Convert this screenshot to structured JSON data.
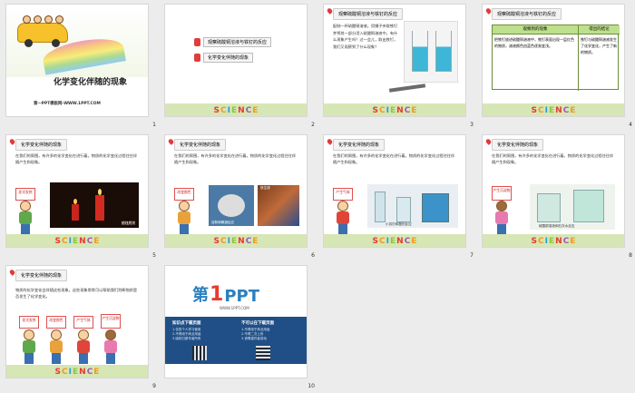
{
  "slides": [
    {
      "num": "1",
      "title": "化学变化伴随的现象",
      "footer": "第一PPT模板网-WWW.1PPT.COM"
    },
    {
      "num": "2",
      "menu": [
        "观察硫酸铜溶液与铁钉的反应",
        "化学变化伴随的现象"
      ]
    },
    {
      "num": "3",
      "header": "观察硫酸铜溶液与铁钉的反应",
      "text": "配制一杯硫酸铜溶液。用镊子夹取铁钉并将其一部分浸入硫酸铜溶液中。有什么现象产生吗？过一会儿，取出铁钉，我们又观察到了什么现象？"
    },
    {
      "num": "4",
      "header": "观察硫酸铜溶液与铁钉的反应",
      "table_head": [
        "观察到的现象",
        "得出的结论"
      ],
      "table_cells": [
        "把铁钉放进硫酸铜溶液中，铁钉表面出现一层红色的物质，溶液颜色由蓝色逐渐变浅。",
        "铁钉与硫酸铜溶液发生了化学变化，产生了新的物质。"
      ]
    },
    {
      "num": "5",
      "header": "化学变化伴随的现象",
      "text": "在我们的周围，有许多的化学变化在进行着。物质的化学变化过程往往伴随产生和现象。",
      "sign": "发光发热",
      "caption": "蜡烛燃烧"
    },
    {
      "num": "6",
      "header": "化学变化伴随的现象",
      "text": "在我们的周围，有许多的化学变化在进行着。物质的化学变化过程往往伴随产生和现象。",
      "sign": "改变颜色",
      "caption1": "铁生锈",
      "caption2": "淀粉和碘酒反应"
    },
    {
      "num": "7",
      "header": "化学变化伴随的现象",
      "text": "在我们的周围，有许多的化学变化在进行着。物质的化学变化过程往往伴随产生和现象。",
      "sign": "产生气体",
      "caption": "小苏打和醋的反应"
    },
    {
      "num": "8",
      "header": "化学变化伴随的现象",
      "text": "在我们的周围，有许多的化学变化在进行着。物质的化学变化过程往往伴随产生和现象。",
      "sign": "产生沉淀物",
      "caption": "硫酸铜溶液和石灰水反应"
    },
    {
      "num": "9",
      "header": "化学变化伴随的现象",
      "text": "物质的化学变化会伴随这些现象，这些现象常常可以帮助我们判断物质是否发生了化学变化。",
      "signs": [
        "发光发热",
        "改变颜色",
        "产生气体",
        "产生沉淀物"
      ]
    },
    {
      "num": "10",
      "logo_main": "第",
      "logo_one": "1",
      "logo_ppt": "PPT",
      "logo_url": "WWW.1PPT.COM",
      "left_title": "知识点下载页面",
      "right_title": "不可以在下载页面",
      "left_lines": [
        "1.仅供个人学习使用",
        "2.不得用于商业用途",
        "3.版权归原作者所有"
      ],
      "right_lines": [
        "1.不得用于商业用途",
        "2.不得二次上传",
        "3.请尊重作者劳动"
      ]
    }
  ],
  "science_letters": [
    "S",
    "C",
    "I",
    "E",
    "N",
    "C",
    "E"
  ],
  "science_colors": [
    "#e8392f",
    "#f19a1c",
    "#2a9bd7",
    "#8cc63f",
    "#e8392f",
    "#9b59b6",
    "#f19a1c"
  ]
}
